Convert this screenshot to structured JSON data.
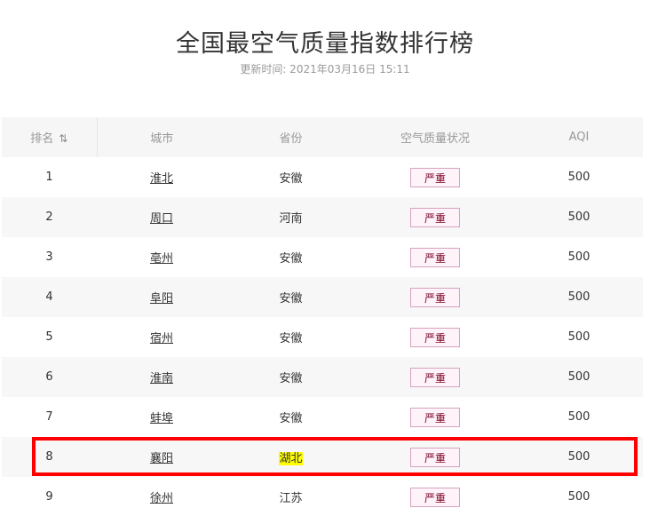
{
  "page": {
    "title": "全国最空气质量指数排行榜",
    "updated": "更新时间: 2021年03月16日 15:11"
  },
  "table": {
    "headers": {
      "rank": "排名",
      "city": "城市",
      "province": "省份",
      "quality": "空气质量状况",
      "aqi": "AQI"
    },
    "sort_icon": "⇅",
    "rows": [
      {
        "rank": "1",
        "city": "淮北",
        "province": "安徽",
        "quality": "严重",
        "aqi": "500"
      },
      {
        "rank": "2",
        "city": "周口",
        "province": "河南",
        "quality": "严重",
        "aqi": "500"
      },
      {
        "rank": "3",
        "city": "亳州",
        "province": "安徽",
        "quality": "严重",
        "aqi": "500"
      },
      {
        "rank": "4",
        "city": "阜阳",
        "province": "安徽",
        "quality": "严重",
        "aqi": "500"
      },
      {
        "rank": "5",
        "city": "宿州",
        "province": "安徽",
        "quality": "严重",
        "aqi": "500"
      },
      {
        "rank": "6",
        "city": "淮南",
        "province": "安徽",
        "quality": "严重",
        "aqi": "500"
      },
      {
        "rank": "7",
        "city": "蚌埠",
        "province": "安徽",
        "quality": "严重",
        "aqi": "500"
      },
      {
        "rank": "8",
        "city": "襄阳",
        "province": "湖北",
        "quality": "严重",
        "aqi": "500"
      },
      {
        "rank": "9",
        "city": "徐州",
        "province": "江苏",
        "quality": "严重",
        "aqi": "500"
      }
    ]
  },
  "colors": {
    "severe_text": "#7e0023",
    "highlight_text_bg": "#ffff00",
    "annotation_box": "#ff0000"
  }
}
